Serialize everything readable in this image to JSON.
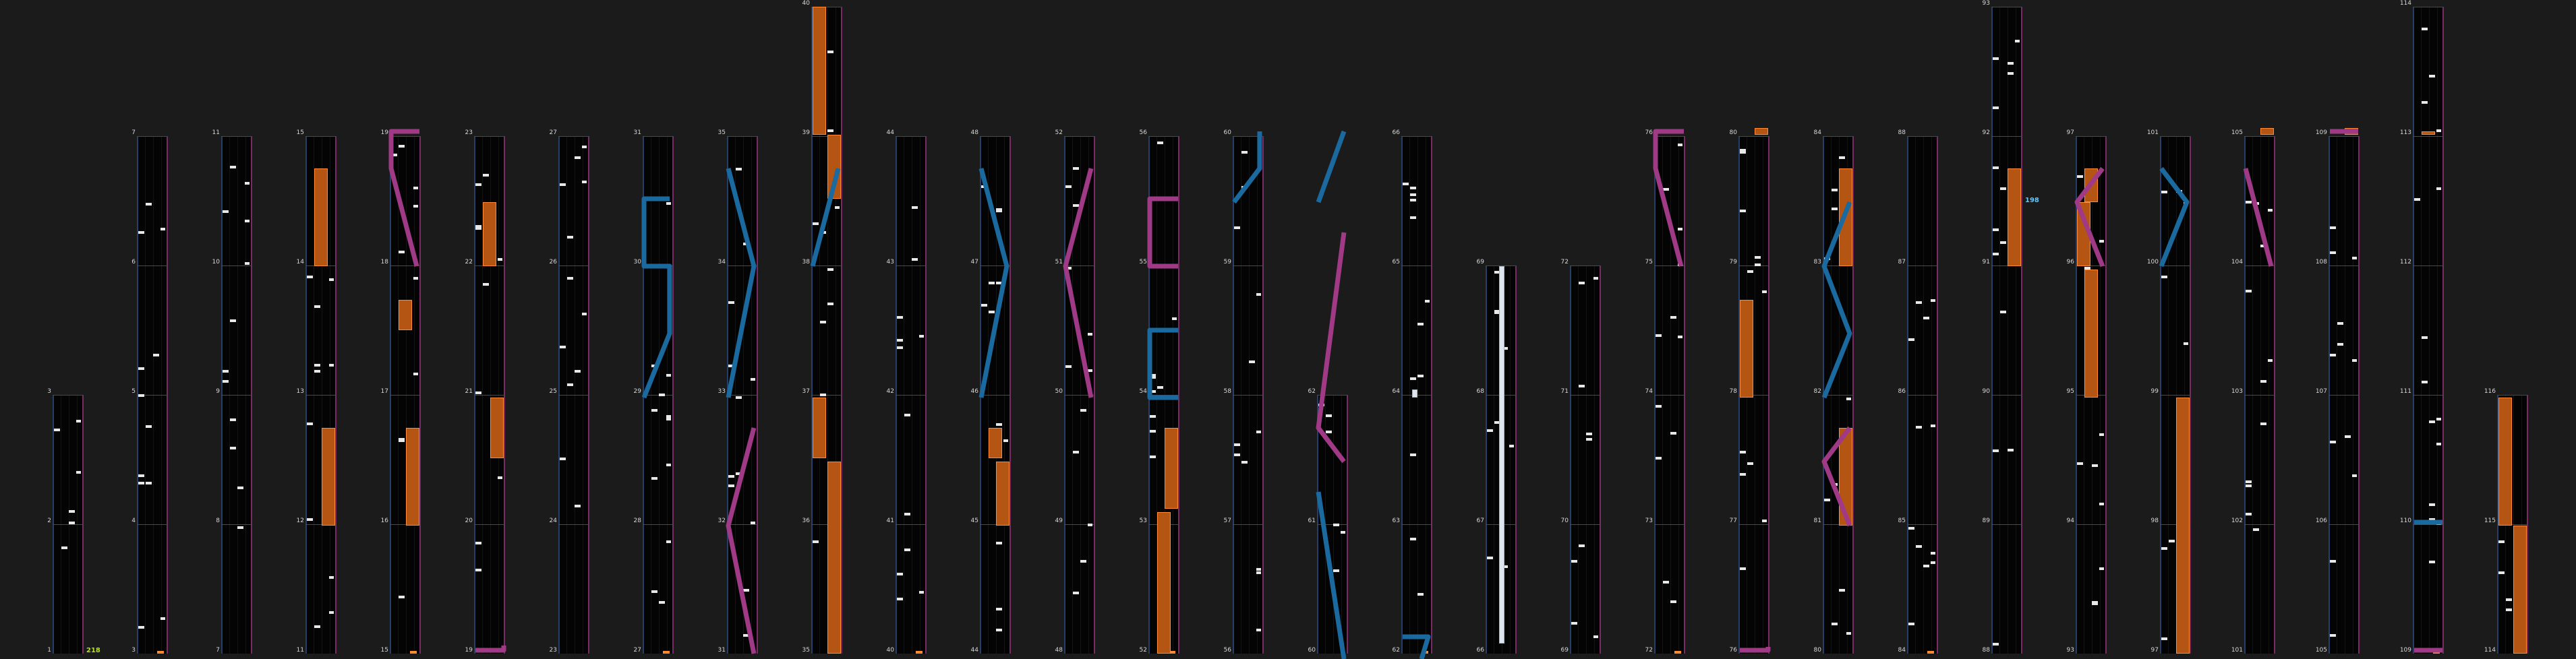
{
  "colors": {
    "background": "#1b1b1b",
    "lane": "#040404",
    "hold": "#b45514",
    "slide_blue": "#1a6aa0",
    "slide_pink": "#a03a86",
    "label_green": "#b6e21e",
    "label_blue": "#5ec8ff"
  },
  "chart": {
    "columns": [
      {
        "m": [
          1,
          2,
          3
        ]
      },
      {
        "m": [
          3,
          4,
          5,
          6,
          7
        ]
      },
      {
        "m": [
          7,
          8,
          9,
          10,
          11
        ]
      },
      {
        "m": [
          11,
          12,
          13,
          14,
          15
        ]
      },
      {
        "m": [
          15,
          16,
          17,
          18,
          19
        ]
      },
      {
        "m": [
          19,
          20,
          21,
          22,
          23
        ]
      },
      {
        "m": [
          23,
          24,
          25,
          26,
          27
        ]
      },
      {
        "m": [
          27,
          28,
          29,
          30,
          31
        ]
      },
      {
        "m": [
          31,
          32,
          33,
          34,
          35
        ]
      },
      {
        "m": [
          35,
          36,
          37,
          38,
          39,
          40
        ]
      },
      {
        "m": [
          40,
          41,
          42,
          43,
          44
        ]
      },
      {
        "m": [
          44,
          45,
          46,
          47,
          48
        ]
      },
      {
        "m": [
          48,
          49,
          50,
          51,
          52
        ]
      },
      {
        "m": [
          52,
          53,
          54,
          55,
          56
        ]
      },
      {
        "m": [
          56,
          57,
          58,
          59,
          60
        ]
      },
      {
        "m": [
          60,
          61,
          62
        ]
      },
      {
        "m": [
          62,
          63,
          64,
          65,
          66
        ]
      },
      {
        "m": [
          66,
          67,
          68,
          69
        ]
      },
      {
        "m": [
          69,
          70,
          71,
          72
        ]
      },
      {
        "m": [
          72,
          73,
          74,
          75,
          76
        ]
      },
      {
        "m": [
          76,
          77,
          78,
          79,
          80
        ]
      },
      {
        "m": [
          80,
          81,
          82,
          83,
          84
        ]
      },
      {
        "m": [
          84,
          85,
          86,
          87,
          88
        ]
      },
      {
        "m": [
          88,
          89,
          90,
          91,
          92,
          93
        ]
      },
      {
        "m": [
          93,
          94,
          95,
          96,
          97
        ]
      },
      {
        "m": [
          97,
          98,
          99,
          100,
          101
        ]
      },
      {
        "m": [
          101,
          102,
          103,
          104,
          105
        ]
      },
      {
        "m": [
          105,
          106,
          107,
          108,
          109
        ]
      },
      {
        "m": [
          109,
          110,
          111,
          112,
          113,
          114
        ]
      },
      {
        "m": [
          114,
          115,
          116
        ]
      }
    ],
    "bottom_labels": [
      {
        "col": 0,
        "text": "218",
        "color": "label_green"
      },
      {
        "col": 23,
        "text": "198",
        "color": "label_blue"
      }
    ]
  }
}
